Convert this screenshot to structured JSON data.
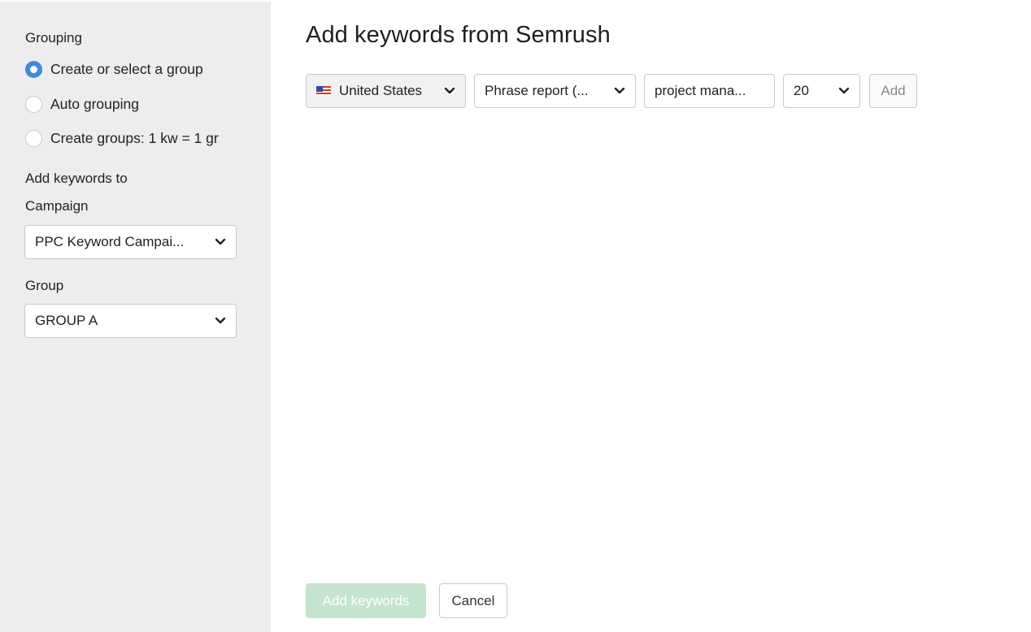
{
  "sidebar": {
    "grouping_heading": "Grouping",
    "grouping_options": [
      {
        "label": "Create or select a group",
        "checked": true
      },
      {
        "label": "Auto grouping",
        "checked": false
      },
      {
        "label": "Create groups: 1 kw = 1 gr",
        "checked": false
      }
    ],
    "add_to_heading": "Add keywords to",
    "campaign_label": "Campaign",
    "campaign_value": "PPC Keyword Campai...",
    "group_label": "Group",
    "group_value": "GROUP A"
  },
  "main": {
    "title": "Add keywords from Semrush",
    "toolbar": {
      "country": "United States",
      "country_flag_icon": "us-flag-icon",
      "report": "Phrase report (...",
      "keyword": "project mana...",
      "count": "20",
      "add_label": "Add"
    },
    "footer": {
      "add_keywords_label": "Add keywords",
      "cancel_label": "Cancel"
    }
  },
  "colors": {
    "sidebar_bg": "#ededed",
    "radio_accent": "#3d8ae0",
    "primary_disabled": "#c5e4cd"
  }
}
